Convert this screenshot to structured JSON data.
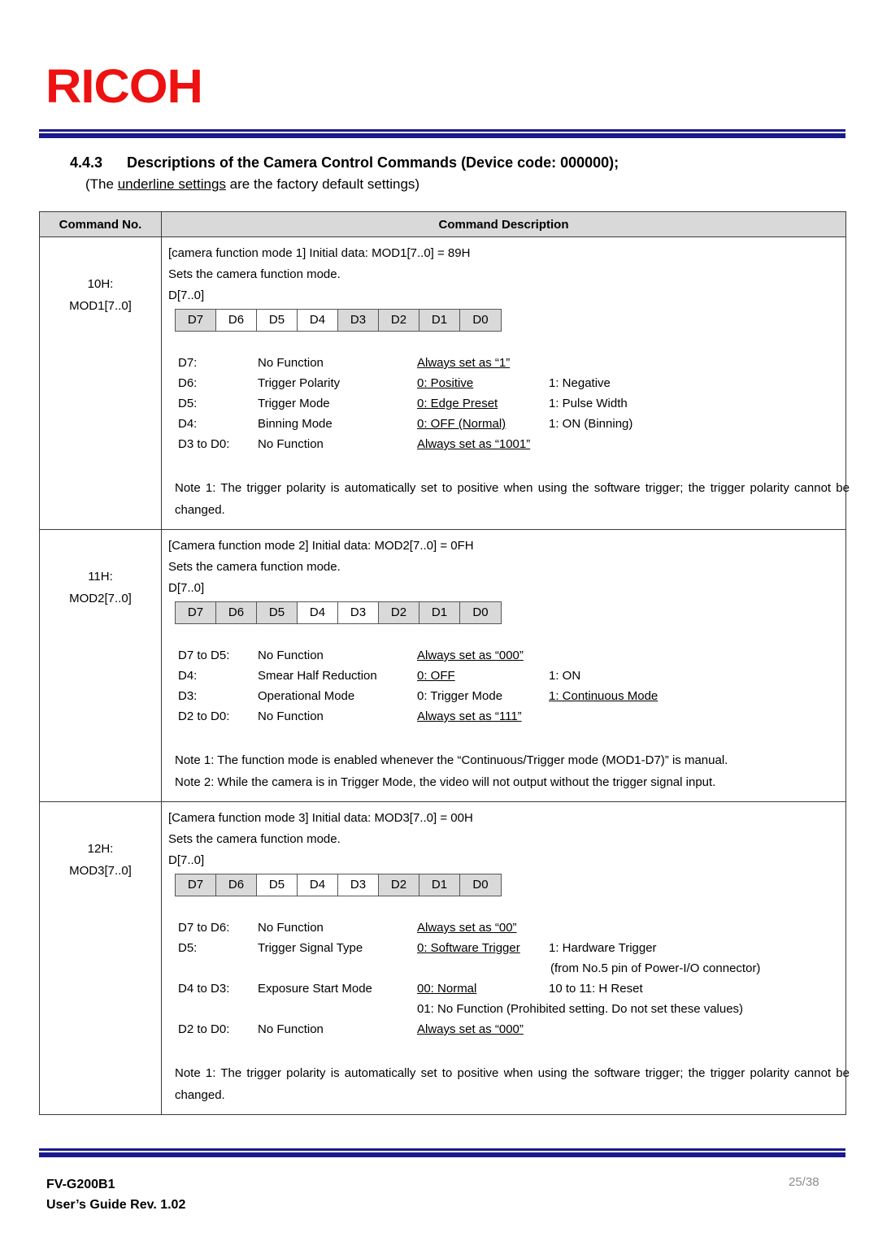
{
  "logo": {
    "text": "RICOH",
    "color": "#ee1111"
  },
  "section": {
    "number": "4.4.3",
    "title": "Descriptions of the Camera Control Commands (Device code: 000000);",
    "subtitle_before": "(The ",
    "subtitle_underlined": "underline settings",
    "subtitle_after": " are the factory default settings)"
  },
  "table": {
    "headers": [
      "Command No.",
      "Command Description"
    ],
    "rows": [
      {
        "command_no": [
          "10H:",
          "MOD1[7..0]"
        ],
        "intro": "[camera function mode 1] Initial data: MOD1[7..0] = 89H",
        "sets": "Sets the camera function mode.",
        "dlabel": "D[7..0]",
        "bits": [
          {
            "label": "D7",
            "shaded": true
          },
          {
            "label": "D6",
            "shaded": false
          },
          {
            "label": "D5",
            "shaded": false
          },
          {
            "label": "D4",
            "shaded": false
          },
          {
            "label": "D3",
            "shaded": true
          },
          {
            "label": "D2",
            "shaded": true
          },
          {
            "label": "D1",
            "shaded": true
          },
          {
            "label": "D0",
            "shaded": true
          }
        ],
        "bit_descriptions": [
          {
            "bit": "D7:",
            "function": "No Function",
            "value0": "Always set as “1”",
            "value0_underlined": true,
            "value1": ""
          },
          {
            "bit": "D6:",
            "function": "Trigger Polarity",
            "value0": "0: Positive",
            "value0_underlined": true,
            "value1": "1: Negative",
            "value1_underlined": false
          },
          {
            "bit": "D5:",
            "function": "Trigger Mode",
            "value0": "0: Edge Preset",
            "value0_underlined": true,
            "value1": "1: Pulse Width",
            "value1_underlined": false
          },
          {
            "bit": "D4:",
            "function": "Binning Mode",
            "value0": "0: OFF (Normal)",
            "value0_underlined": true,
            "value1": "1: ON (Binning)",
            "value1_underlined": false
          },
          {
            "bit": "D3 to D0:",
            "function": "No Function",
            "value0": "Always set as “1001”",
            "value0_underlined": true,
            "value1": ""
          }
        ],
        "notes": [
          {
            "text": "Note 1:  The  trigger  polarity  is  automatically  set  to  positive  when  using  the  software  trigger;  the  trigger  polarity cannot be changed.",
            "justified": true
          }
        ]
      },
      {
        "command_no": [
          "11H:",
          "MOD2[7..0]"
        ],
        "intro": "[Camera function mode 2] Initial data: MOD2[7..0] = 0FH",
        "sets": "Sets the camera function mode.",
        "dlabel": "D[7..0]",
        "bits": [
          {
            "label": "D7",
            "shaded": true
          },
          {
            "label": "D6",
            "shaded": true
          },
          {
            "label": "D5",
            "shaded": true
          },
          {
            "label": "D4",
            "shaded": false
          },
          {
            "label": "D3",
            "shaded": false
          },
          {
            "label": "D2",
            "shaded": true
          },
          {
            "label": "D1",
            "shaded": true
          },
          {
            "label": "D0",
            "shaded": true
          }
        ],
        "bit_descriptions": [
          {
            "bit": "D7 to D5:",
            "function": "No Function",
            "value0": "Always set as “000”",
            "value0_underlined": true,
            "value1": ""
          },
          {
            "bit": "D4:",
            "function": "Smear Half Reduction",
            "value0": "0: OFF",
            "value0_underlined": true,
            "value1": "1: ON",
            "value1_underlined": false
          },
          {
            "bit": "D3:",
            "function": "Operational Mode",
            "value0": "0: Trigger Mode",
            "value0_underlined": false,
            "value1": "1: Continuous Mode",
            "value1_underlined": true
          },
          {
            "bit": "D2 to D0:",
            "function": "No Function",
            "value0": "Always set as “111”",
            "value0_underlined": true,
            "value1": ""
          }
        ],
        "notes": [
          {
            "text": "Note 1: The function mode is enabled whenever the “Continuous/Trigger mode (MOD1-D7)” is manual.",
            "justified": false
          },
          {
            "text": "Note 2: While the camera is in Trigger Mode, the video will not output without the trigger signal input.",
            "justified": false
          }
        ]
      },
      {
        "command_no": [
          "12H:",
          "MOD3[7..0]"
        ],
        "intro": "[Camera function mode 3] Initial data: MOD3[7..0] = 00H",
        "sets": "Sets the camera function mode.",
        "dlabel": "D[7..0]",
        "bits": [
          {
            "label": "D7",
            "shaded": true
          },
          {
            "label": "D6",
            "shaded": true
          },
          {
            "label": "D5",
            "shaded": false
          },
          {
            "label": "D4",
            "shaded": false
          },
          {
            "label": "D3",
            "shaded": false
          },
          {
            "label": "D2",
            "shaded": true
          },
          {
            "label": "D1",
            "shaded": true
          },
          {
            "label": "D0",
            "shaded": true
          }
        ],
        "bit_descriptions": [
          {
            "bit": "D7 to D6:",
            "function": "No Function",
            "value0": "Always set as “00”",
            "value0_underlined": true,
            "value1": ""
          },
          {
            "bit": "D5:",
            "function": "Trigger Signal Type",
            "value0": "0: Software Trigger",
            "value0_underlined": true,
            "value1": "1: Hardware Trigger",
            "value1_underlined": false
          },
          {
            "bit": "",
            "function": "",
            "value0": "",
            "value0_underlined": false,
            "value1": "(from No.5 pin of Power-I/O connector)",
            "value1_underlined": false
          },
          {
            "bit": "D4 to D3:",
            "function": "Exposure Start Mode",
            "value0": "00: Normal",
            "value0_underlined": true,
            "value1": "10 to 11: H Reset",
            "value1_underlined": false
          },
          {
            "bit": "",
            "function": "",
            "value0": "01: No Function (Prohibited setting. Do not set these values)",
            "value0_underlined": false,
            "value1": "",
            "indent_v0": true
          },
          {
            "bit": "D2 to D0:",
            "function": "No Function",
            "value0": "Always set as “000”",
            "value0_underlined": true,
            "value1": ""
          }
        ],
        "notes": [
          {
            "text": "Note 1:  The  trigger  polarity  is  automatically  set  to  positive  when  using  the  software  trigger;  the  trigger  polarity cannot be changed.",
            "justified": true
          }
        ]
      }
    ]
  },
  "footer": {
    "model": "FV-G200B1",
    "guide": "User’s Guide Rev. 1.02",
    "page": "25/38"
  }
}
